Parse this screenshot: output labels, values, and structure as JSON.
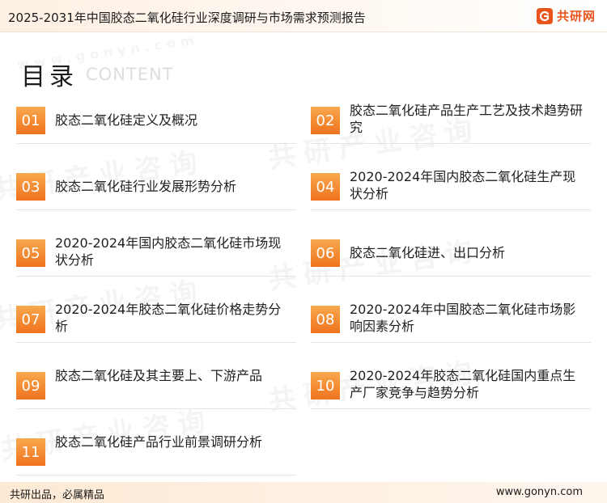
{
  "header": {
    "title": "2025-2031年中国胶态二氧化硅行业深度调研与市场需求预测报告",
    "brand_name": "共研网",
    "brand_color": "#e8541c"
  },
  "watermark": {
    "text": "共研产业咨询",
    "url": "www.gonyn.com"
  },
  "toc": {
    "title": "目录",
    "subtitle": "CONTENT",
    "items": [
      {
        "num": "01",
        "label": "胶态二氧化硅定义及概况"
      },
      {
        "num": "02",
        "label": "胶态二氧化硅产品生产工艺及技术趋势研究"
      },
      {
        "num": "03",
        "label": "胶态二氧化硅行业发展形势分析"
      },
      {
        "num": "04",
        "label": "2020-2024年国内胶态二氧化硅生产现状分析"
      },
      {
        "num": "05",
        "label": "2020-2024年国内胶态二氧化硅市场现状分析"
      },
      {
        "num": "06",
        "label": "胶态二氧化硅进、出口分析"
      },
      {
        "num": "07",
        "label": "2020-2024年胶态二氧化硅价格走势分析"
      },
      {
        "num": "08",
        "label": "2020-2024年中国胶态二氧化硅市场影响因素分析"
      },
      {
        "num": "09",
        "label": "胶态二氧化硅及其主要上、下游产品"
      },
      {
        "num": "10",
        "label": "2020-2024年胶态二氧化硅国内重点生产厂家竞争与趋势分析"
      },
      {
        "num": "11",
        "label": "胶态二氧化硅产品行业前景调研分析"
      }
    ],
    "accent_color": "#f0731f"
  },
  "footer": {
    "slogan": "共研出品，必属精品",
    "url": "www.gonyn.com"
  }
}
